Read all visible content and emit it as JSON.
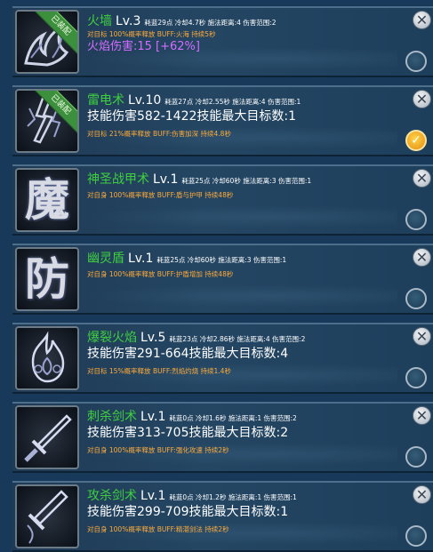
{
  "skills": [
    {
      "name": "火墙",
      "level": "Lv.3",
      "meta": "耗蓝29点 冷却4.7秒 施法距离:4 伤害范围:2",
      "buff": "对目标 100%概率释放 BUFF:火海 持续5秒",
      "damage": "火焰伤害:15 [+62%]",
      "equipped_badge": "已装配",
      "selected": false,
      "icon": "fire-wall-icon"
    },
    {
      "name": "雷电术",
      "level": "Lv.10",
      "meta": "耗蓝27点 冷却2.55秒 施法距离:4 伤害范围:1",
      "damage": "技能伤害582-1422技能最大目标数:1",
      "buff": "对目标 21%概率释放 BUFF:伤害加深 持续4.8秒",
      "equipped_badge": "已装配",
      "selected": true,
      "icon": "lightning-icon"
    },
    {
      "name": "神圣战甲术",
      "level": "Lv.1",
      "meta": "耗蓝25点 冷却60秒 施法距离:3 伤害范围:1",
      "buff": "对自身 100%概率释放 BUFF:盾与护甲 持续48秒",
      "selected": false,
      "icon_glyph": "魔",
      "icon": "magic-armor-icon"
    },
    {
      "name": "幽灵盾",
      "level": "Lv.1",
      "meta": "耗蓝25点 冷却60秒 施法距离:3 伤害范围:1",
      "buff": "对自身 100%概率释放 BUFF:护盾增加 持续48秒",
      "selected": false,
      "icon_glyph": "防",
      "icon": "defense-shield-icon"
    },
    {
      "name": "爆裂火焰",
      "level": "Lv.5",
      "meta": "耗蓝23点 冷却2.86秒 施法距离:4 伤害范围:2",
      "damage": "技能伤害291-664技能最大目标数:4",
      "buff": "对目标 15%概率释放 BUFF:烈焰灼烧 持续1.4秒",
      "selected": false,
      "icon": "blue-flame-icon"
    },
    {
      "name": "刺杀剑术",
      "level": "Lv.1",
      "meta": "耗蓝0点 冷却1.6秒 施法距离:1 伤害范围:2",
      "damage": "技能伤害313-705技能最大目标数:2",
      "buff": "对自身 100%概率释放 BUFF:强化攻速 持续2秒",
      "selected": false,
      "icon": "sword-thrust-icon"
    },
    {
      "name": "攻杀剑术",
      "level": "Lv.1",
      "meta": "耗蓝0点 冷却1.2秒 施法距离:1 伤害范围:1",
      "damage": "技能伤害299-709技能最大目标数:1",
      "buff": "对自身 100%概率释放 BUFF:精湛剑法 持续2秒",
      "selected": false,
      "icon": "sword-strike-icon"
    }
  ],
  "colors": {
    "skill_name": "#3fcf3f",
    "buff_text": "#ffab3a",
    "fire_damage": "#d46cff",
    "badge": "#3c8f3c"
  }
}
